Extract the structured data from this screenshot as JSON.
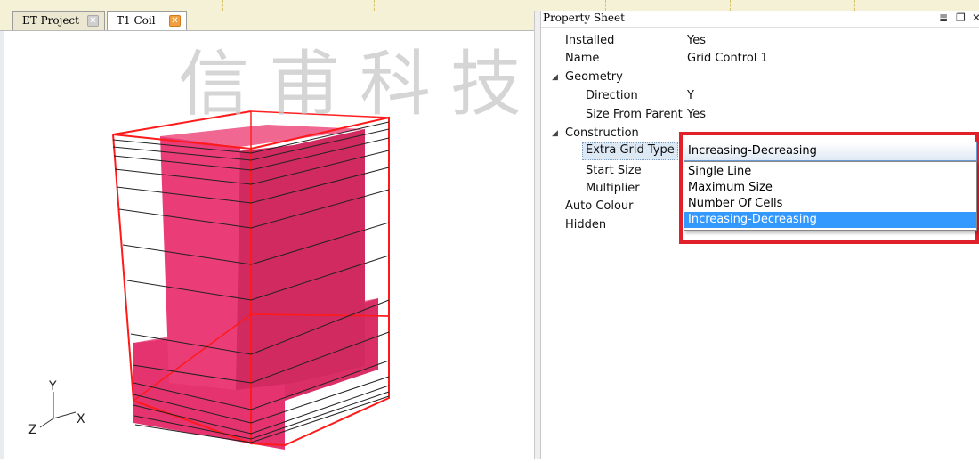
{
  "tabs": [
    {
      "label": "ET Project",
      "close_icon": "close-icon"
    },
    {
      "label": "T1 Coil",
      "close_icon": "close-icon"
    }
  ],
  "watermark": "信甫科技",
  "axes": {
    "y": "Y",
    "x": "X",
    "z": "Z"
  },
  "property_sheet": {
    "title": "Property Sheet",
    "rows": {
      "installed": {
        "label": "Installed",
        "value": "Yes"
      },
      "name": {
        "label": "Name",
        "value": "Grid Control 1"
      },
      "geometry": {
        "label": "Geometry"
      },
      "direction": {
        "label": "Direction",
        "value": "Y"
      },
      "size_from_parent": {
        "label": "Size From Parent",
        "value": "Yes"
      },
      "construction": {
        "label": "Construction"
      },
      "extra_grid_type": {
        "label": "Extra Grid Type",
        "value": "Increasing-Decreasing"
      },
      "start_size": {
        "label": "Start Size"
      },
      "multiplier": {
        "label": "Multiplier"
      },
      "auto_colour": {
        "label": "Auto Colour"
      },
      "hidden": {
        "label": "Hidden"
      }
    }
  },
  "dropdown": {
    "selected": "Increasing-Decreasing",
    "options": [
      "Single Line",
      "Maximum Size",
      "Number Of Cells",
      "Increasing-Decreasing"
    ]
  },
  "colors": {
    "coil": "#e8326e",
    "highlight_box": "#e0202a",
    "selection": "#3399ff"
  }
}
